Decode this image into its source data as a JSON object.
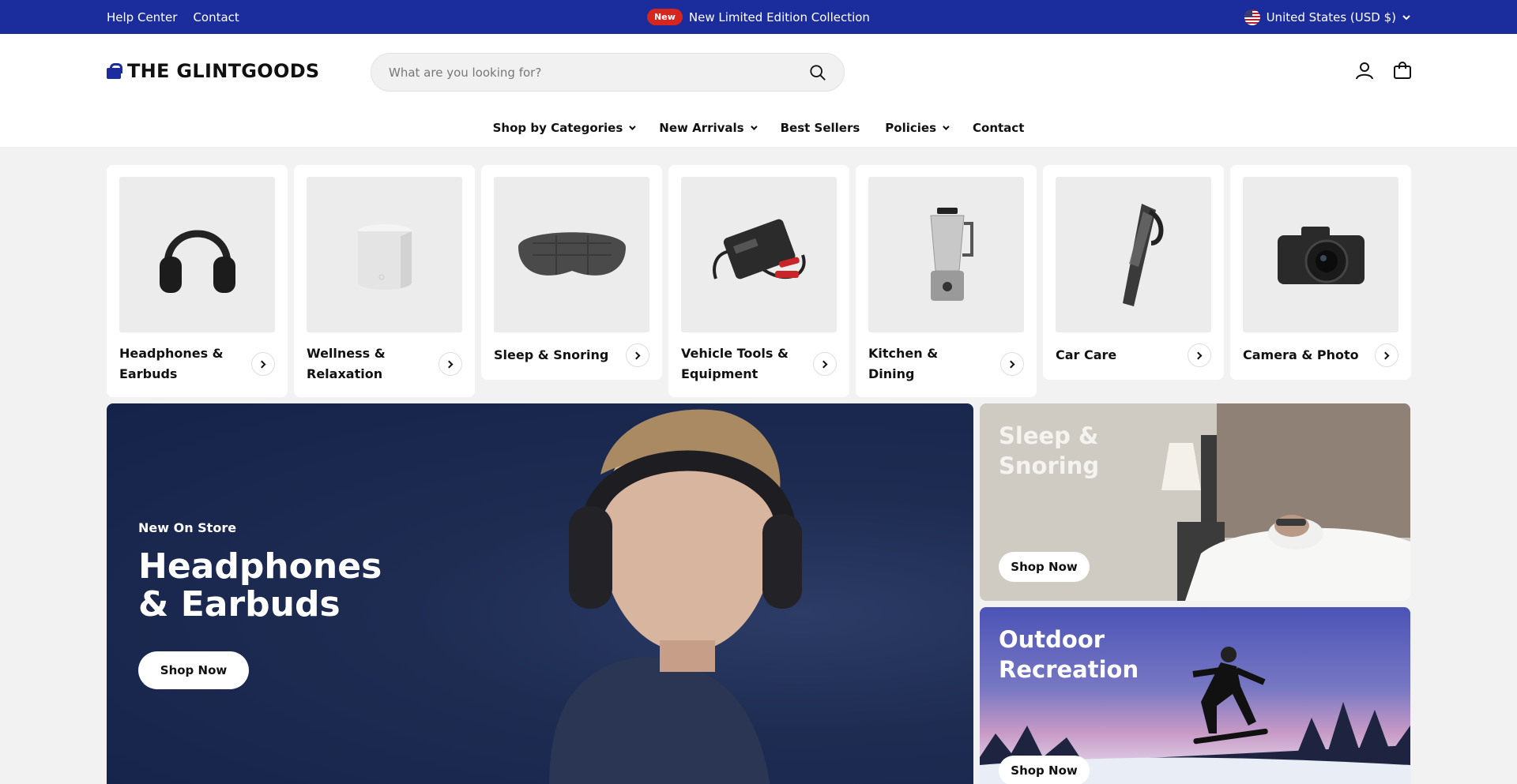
{
  "announcement": {
    "links": [
      "Help Center",
      "Contact"
    ],
    "badge": "New",
    "message": "New Limited Edition Collection",
    "locale": "United States (USD $)",
    "bg_color": "#1b2c9c",
    "badge_color": "#d7261e"
  },
  "header": {
    "logo_text": "THE GLINTGOODS",
    "search_placeholder": "What are you looking for?"
  },
  "nav": {
    "items": [
      {
        "label": "Shop by Categories",
        "has_dropdown": true
      },
      {
        "label": "New Arrivals",
        "has_dropdown": true
      },
      {
        "label": "Best Sellers",
        "has_dropdown": false
      },
      {
        "label": "Policies",
        "has_dropdown": true
      },
      {
        "label": "Contact",
        "has_dropdown": false
      }
    ]
  },
  "categories": [
    {
      "label": "Headphones & Earbuds",
      "icon": "headphones-icon"
    },
    {
      "label": "Wellness & Relaxation",
      "icon": "speaker-icon"
    },
    {
      "label": "Sleep & Snoring",
      "icon": "sleep-mask-icon"
    },
    {
      "label": "Vehicle Tools & Equipment",
      "icon": "jump-starter-icon"
    },
    {
      "label": "Kitchen & Dining",
      "icon": "blender-icon"
    },
    {
      "label": "Car Care",
      "icon": "handheld-vacuum-icon"
    },
    {
      "label": "Camera & Photo",
      "icon": "camera-icon"
    }
  ],
  "hero": {
    "eyebrow": "New On Store",
    "title": "Headphones & Earbuds",
    "button": "Shop Now"
  },
  "promos": [
    {
      "title": "Sleep & Snoring",
      "button": "Shop Now"
    },
    {
      "title": "Outdoor Recreation",
      "button": "Shop Now"
    }
  ]
}
